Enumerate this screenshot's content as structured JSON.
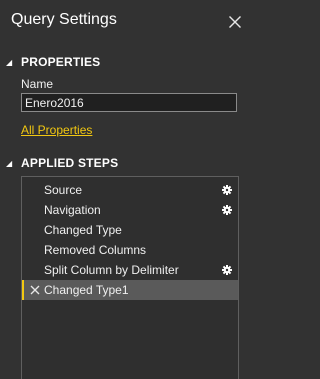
{
  "panel": {
    "title": "Query Settings"
  },
  "properties": {
    "header": "PROPERTIES",
    "name_label": "Name",
    "name_value": "Enero2016",
    "all_properties_link": "All Properties"
  },
  "applied_steps": {
    "header": "APPLIED STEPS",
    "steps": [
      {
        "label": "Source",
        "has_settings": true,
        "selected": false
      },
      {
        "label": "Navigation",
        "has_settings": true,
        "selected": false
      },
      {
        "label": "Changed Type",
        "has_settings": false,
        "selected": false
      },
      {
        "label": "Removed Columns",
        "has_settings": false,
        "selected": false
      },
      {
        "label": "Split Column by Delimiter",
        "has_settings": true,
        "selected": false
      },
      {
        "label": "Changed Type1",
        "has_settings": false,
        "selected": true
      }
    ]
  },
  "colors": {
    "background": "#323232",
    "accent": "#f2c811",
    "selected_row": "#5a5a5a",
    "input_bg": "#202020"
  },
  "icons": {
    "close": "close-icon",
    "settings": "gear-icon",
    "delete": "delete-step-icon",
    "collapse": "triangle-down-icon"
  }
}
